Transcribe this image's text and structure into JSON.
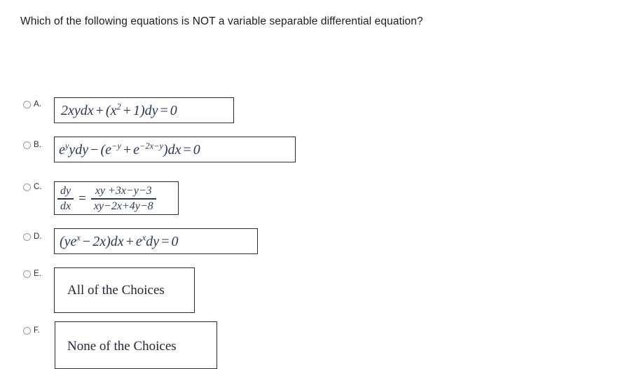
{
  "question": {
    "text": "Which of the following equations is NOT a variable separable differential equation?"
  },
  "options": [
    {
      "letter": "A.",
      "kind": "equation",
      "latex_like": "2xydx + (x^2 + 1)dy = 0",
      "parts": {
        "p1": "2xydx",
        "op1": "+",
        "p2": "(x",
        "sup2": "2",
        "op2": "+",
        "p3": "1)dy",
        "op3": "=",
        "p4": "0"
      }
    },
    {
      "letter": "B.",
      "kind": "equation",
      "latex_like": "e^y ydy - (e^-y + e^(-2x-y))dx = 0",
      "parts": {
        "p1": "e",
        "sup1": "y",
        "p2": "ydy",
        "op1": "−",
        "p3": "(e",
        "sup2": "−y",
        "op2": "+",
        "p4": "e",
        "sup3": "−2x−y",
        "p5": ")dx",
        "op3": "=",
        "p6": "0"
      }
    },
    {
      "letter": "C.",
      "kind": "fraction",
      "latex_like": "dy/dx = (xy +3x-y-3)/(xy-2x+4y-8)",
      "parts": {
        "lhs_top": "dy",
        "lhs_bot": "dx",
        "equals": "=",
        "rhs_top": "xy +3x−y−3",
        "rhs_bot": "xy−2x+4y−8"
      }
    },
    {
      "letter": "D.",
      "kind": "equation",
      "latex_like": "(ye^x - 2x)dx + e^x dy = 0",
      "parts": {
        "p1": "(ye",
        "sup1": "x",
        "op1": "−",
        "p2": "2x)dx",
        "op2": "+",
        "p3": "e",
        "sup2": "x",
        "p4": "dy",
        "op3": "=",
        "p5": "0"
      }
    },
    {
      "letter": "E.",
      "kind": "text",
      "text": "All of the Choices"
    },
    {
      "letter": "F.",
      "kind": "text",
      "text": "None of the Choices"
    }
  ],
  "colors": {
    "page_background": "#ffffff",
    "question_text": "#1d1d1d",
    "equation_text": "#2b3a52",
    "box_border": "#2e2e2e",
    "radio_border": "#9a9a9a"
  }
}
